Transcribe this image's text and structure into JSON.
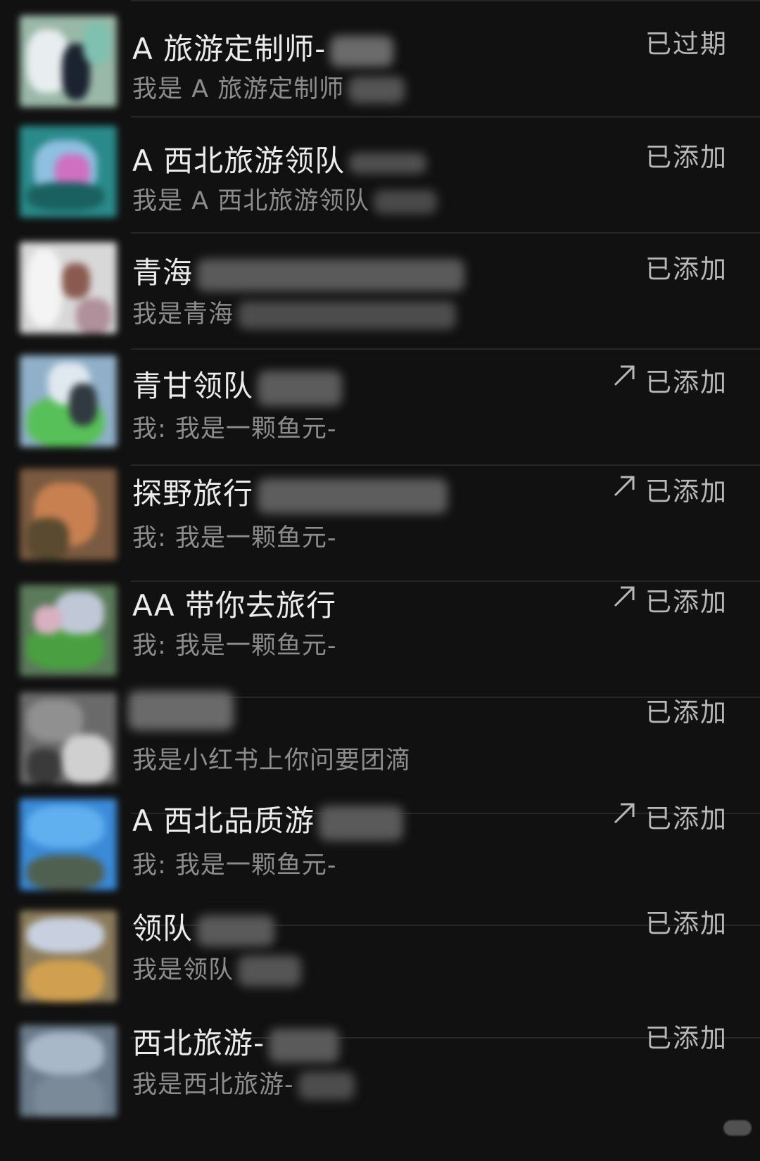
{
  "contacts": [
    {
      "name": "A 旅游定制师-",
      "message": "我是 A 旅游定制师",
      "status": "已过期",
      "forwarded": false
    },
    {
      "name": "A 西北旅游领队",
      "message": "我是 A 西北旅游领队",
      "status": "已添加",
      "forwarded": false
    },
    {
      "name": "青海",
      "message": "我是青海",
      "status": "已添加",
      "forwarded": false
    },
    {
      "name": "青甘领队",
      "message": "我: 我是一颗鱼元-",
      "status": "已添加",
      "forwarded": true
    },
    {
      "name": "探野旅行",
      "message": "我: 我是一颗鱼元-",
      "status": "已添加",
      "forwarded": true
    },
    {
      "name": "AA 带你去旅行",
      "message": "我: 我是一颗鱼元-",
      "status": "已添加",
      "forwarded": true
    },
    {
      "name": "",
      "message": "我是小红书上你问要团滴",
      "status": "已添加",
      "forwarded": false
    },
    {
      "name": "A 西北品质游",
      "message": "我: 我是一颗鱼元-",
      "status": "已添加",
      "forwarded": true
    },
    {
      "name": "领队",
      "message": "我是领队",
      "status": "已添加",
      "forwarded": false
    },
    {
      "name": "西北旅游-",
      "message": "我是西北旅游-",
      "status": "已添加",
      "forwarded": false
    }
  ],
  "icons": {
    "forwarded": "arrow-up-right-icon"
  },
  "colors": {
    "background": "#111111",
    "name_text": "#ececec",
    "message_text": "#8d8d8d",
    "status_text": "#b8b8b8"
  }
}
